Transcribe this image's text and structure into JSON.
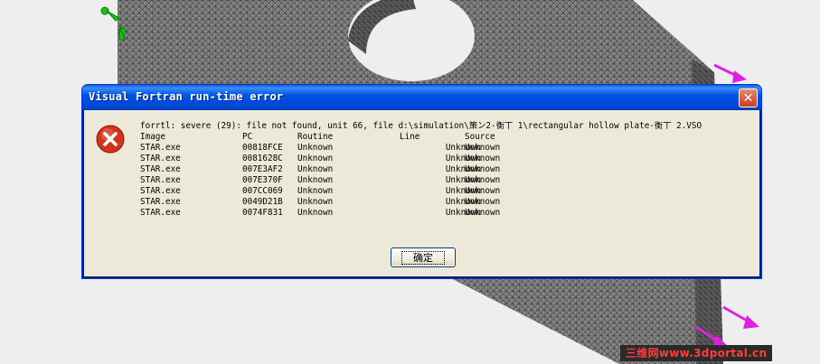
{
  "dialog": {
    "title": "Visual Fortran run-time error",
    "close_glyph": "✕",
    "icon": "error-icon",
    "message": "forrtl: severe (29): file not found, unit 66, file d:\\simulation\\策ン2-衡丅 1\\rectangular hollow plate-衡丅 2.VSO",
    "columns": [
      "Image",
      "PC",
      "Routine",
      "Line",
      "Source"
    ],
    "rows": [
      [
        "STAR.exe",
        "00818FCE",
        "Unknown",
        "Unknown",
        "Unknown"
      ],
      [
        "STAR.exe",
        "0081628C",
        "Unknown",
        "Unknown",
        "Unknown"
      ],
      [
        "STAR.exe",
        "007E3AF2",
        "Unknown",
        "Unknown",
        "Unknown"
      ],
      [
        "STAR.exe",
        "007E370F",
        "Unknown",
        "Unknown",
        "Unknown"
      ],
      [
        "STAR.exe",
        "007CC069",
        "Unknown",
        "Unknown",
        "Unknown"
      ],
      [
        "STAR.exe",
        "0049D21B",
        "Unknown",
        "Unknown",
        "Unknown"
      ],
      [
        "STAR.exe",
        "0074F831",
        "Unknown",
        "Unknown",
        "Unknown"
      ]
    ],
    "ok_label": "确定"
  },
  "watermark": "三维网www.3dportal.cn",
  "colors": {
    "title_bar": "#0055e5",
    "dialog_bg": "#ece9d8",
    "error_red": "#d3321c",
    "load_arrow": "#e020e0",
    "fixture_green": "#19c419"
  }
}
